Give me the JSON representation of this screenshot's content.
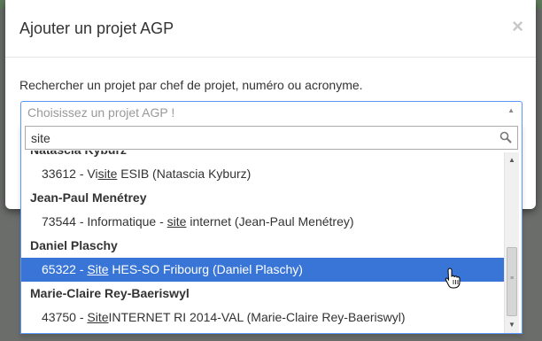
{
  "modal": {
    "title": "Ajouter un projet AGP",
    "close_label": "×",
    "instruction": "Rechercher un projet par chef de projet, numéro ou acronyme."
  },
  "select": {
    "placeholder": "Choisissez un projet AGP !",
    "arrow_icon": "caret-up-icon"
  },
  "search": {
    "value": "site",
    "icon": "search-icon"
  },
  "results": {
    "partial_group": "Natascia Kyburz",
    "items": [
      {
        "type": "option",
        "pre": "33612 - Vi",
        "match": "site",
        "post": " ESIB (Natascia Kyburz)",
        "highlighted": false
      },
      {
        "type": "group",
        "label": "Jean-Paul Menétrey"
      },
      {
        "type": "option",
        "pre": "73544 - Informatique - ",
        "match": "site",
        "post": " internet (Jean-Paul Menétrey)",
        "highlighted": false
      },
      {
        "type": "group",
        "label": "Daniel Plaschy"
      },
      {
        "type": "option",
        "pre": "65322 - ",
        "match": "Site",
        "post": " HES-SO Fribourg (Daniel Plaschy)",
        "highlighted": true
      },
      {
        "type": "group",
        "label": "Marie-Claire Rey-Baeriswyl"
      },
      {
        "type": "option",
        "pre": "43750 - ",
        "match": "Site",
        "post": "INTERNET RI 2014-VAL (Marie-Claire Rey-Baeriswyl)",
        "highlighted": false
      }
    ]
  },
  "colors": {
    "highlight": "#3875d7",
    "focus_border": "#5897fb",
    "backdrop": "#6b6d6b"
  }
}
